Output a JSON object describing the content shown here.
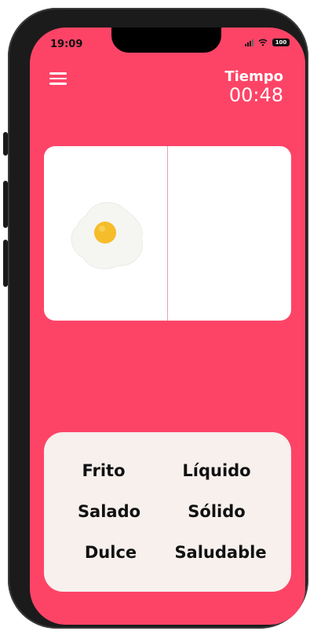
{
  "status_bar": {
    "time": "19:09",
    "battery": "100"
  },
  "header": {
    "menu_icon": "hamburger-menu-icon",
    "timer_label": "Tiempo",
    "timer_value": "00:48"
  },
  "card": {
    "left_image": "fried-egg",
    "right_image": ""
  },
  "words": [
    "Frito",
    "Líquido",
    "Salado",
    "Sólido",
    "Dulce",
    "Saludable"
  ],
  "colors": {
    "background": "#fd4467",
    "card": "#ffffff",
    "words_panel": "#f7f0ed",
    "text": "#111111"
  }
}
